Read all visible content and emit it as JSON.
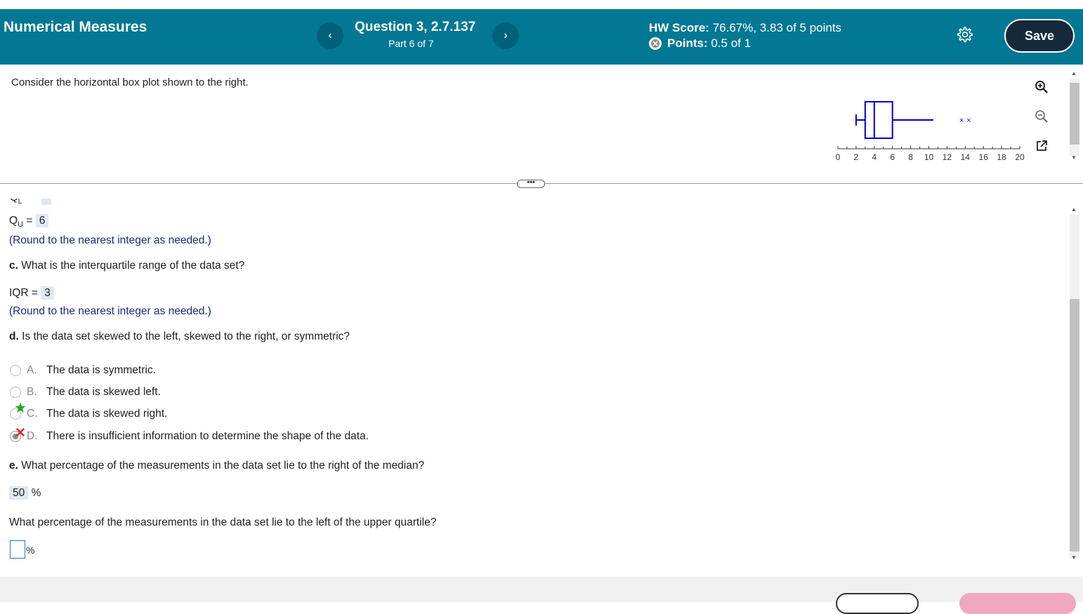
{
  "header": {
    "title": "Numerical Measures",
    "question": "Question 3, 2.7.137",
    "part": "Part 6 of 7",
    "hw_label": "HW Score:",
    "hw_value": "76.67%, 3.83 of 5 points",
    "points_label": "Points:",
    "points_value": "0.5 of 1",
    "save_label": "Save",
    "prev_glyph": "‹",
    "next_glyph": "›"
  },
  "prompt": "Consider the horizontal box plot shown to the right.",
  "boxplot": {
    "axis_min": 0,
    "axis_max": 20,
    "tick_labels": [
      "0",
      "2",
      "4",
      "6",
      "8",
      "10",
      "12",
      "14",
      "16",
      "18",
      "20"
    ],
    "whisker_low": 2,
    "q1": 3,
    "median": 4,
    "q3": 6,
    "whisker_high": 10.5,
    "outliers": [
      13.6,
      14.4
    ],
    "color": "#0000cc"
  },
  "divider_glyph": "•••",
  "lower": {
    "qu_label": "Q",
    "qu_sub": "U",
    "qu_eq": " = ",
    "qu_value": "6",
    "round_note_1": "(Round to the nearest integer as needed.)",
    "c_letter": "c.",
    "c_text": " What is the interquartile range of the data set?",
    "iqr_label": "IQR = ",
    "iqr_value": "3",
    "round_note_2": "(Round to the nearest integer as needed.)",
    "d_letter": "d.",
    "d_text": " Is the data set skewed to the left, skewed to the right, or symmetric?",
    "options": [
      {
        "letter": "A.",
        "text": "The data is symmetric."
      },
      {
        "letter": "B.",
        "text": "The data is skewed left."
      },
      {
        "letter": "C.",
        "text": "The data is skewed right."
      },
      {
        "letter": "D.",
        "text": "There is insufficient information to determine the shape of the data."
      }
    ],
    "e_letter": "e.",
    "e_text": " What percentage of the measurements in the data set lie to the right of the median?",
    "median_pct_value": "50",
    "pct_sign": "%",
    "upper_q_text": "What percentage of the measurements in the data set lie to the left of the upper quartile?",
    "pct_sign_2": "%"
  },
  "colors": {
    "header_bg": "#027894",
    "save_bg": "#15293a",
    "correct_star": "#22aa22",
    "wrong_x": "#e02020"
  }
}
